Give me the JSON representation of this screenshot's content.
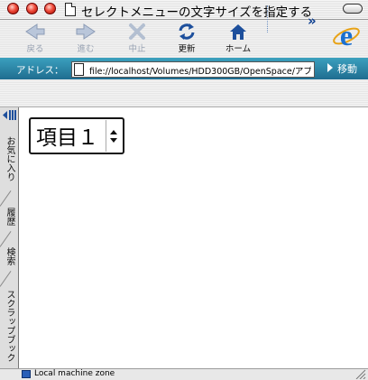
{
  "window": {
    "title": "セレクトメニューの文字サイズを指定する"
  },
  "toolbar": {
    "back_label": "戻る",
    "forward_label": "進む",
    "stop_label": "中止",
    "refresh_label": "更新",
    "home_label": "ホーム",
    "more_symbol": "»"
  },
  "address": {
    "label": "アドレス：",
    "url": "file://localhost/Volumes/HDD300GB/OpenSpace/アプリ!",
    "go_label": "移動"
  },
  "sidebar": {
    "tabs": [
      "お気に入り",
      "履歴",
      "検索",
      "スクラップブック"
    ]
  },
  "content": {
    "select": {
      "selected_value": "項目１"
    }
  },
  "status": {
    "zone_text": "Local machine zone"
  },
  "colors": {
    "address_bar": "#2a88ab",
    "traffic_light": "#e0392a",
    "ie_blue": "#1a6fd0"
  }
}
